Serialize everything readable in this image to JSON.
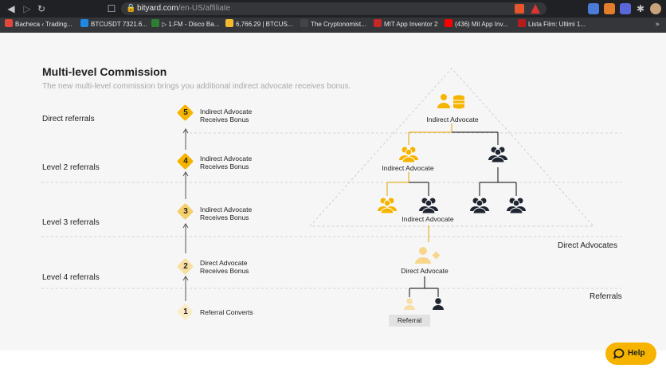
{
  "browser": {
    "url_host": "bityard.com",
    "url_path": "/en-US/affiliate",
    "bookmarks": [
      {
        "label": "Bacheca ‹ Trading...",
        "color": "#e0483e"
      },
      {
        "label": "BTCUSDT 7321.6...",
        "color": "#1e88e5"
      },
      {
        "label": "▷ 1.FM - Disco Ba...",
        "color": "#2e7d32"
      },
      {
        "label": "6,766.29 | BTCUS...",
        "color": "#f3ba2f"
      },
      {
        "label": "The Cryptonomist...",
        "color": "#444444"
      },
      {
        "label": "MIT App Inventor 2",
        "color": "#c62828"
      },
      {
        "label": "(436) Mit App Inv...",
        "color": "#ff0000"
      },
      {
        "label": "Lista Film: Ultimi 1...",
        "color": "#b71c1c"
      }
    ],
    "bookmarks_more": "»"
  },
  "page": {
    "title": "Multi-level Commission",
    "subtitle": "The new multi-level commission brings you additional indirect advocate receives bonus.",
    "levels": {
      "direct": "Direct referrals",
      "level2": "Level 2 referrals",
      "level3": "Level 3 referrals",
      "level4": "Level 4 referrals"
    },
    "steps": [
      {
        "num": "5",
        "line1": "Indirect Advocate",
        "line2": "Receives Bonus",
        "state": "active"
      },
      {
        "num": "4",
        "line1": "Indirect Advocate",
        "line2": "Receives Bonus",
        "state": "active"
      },
      {
        "num": "3",
        "line1": "Indirect Advocate",
        "line2": "Receives Bonus",
        "state": "medium"
      },
      {
        "num": "2",
        "line1": "Direct Advocate",
        "line2": "Receives Bonus",
        "state": "light"
      },
      {
        "num": "1",
        "line1": "Referral Converts",
        "line2": "",
        "state": "lightest"
      }
    ],
    "nodes": {
      "top": "Indirect Advocate",
      "level2": "Indirect Advocate",
      "level3": "Indirect Advocate",
      "direct": "Direct Advocate",
      "referral": "Referral"
    },
    "side_labels": {
      "direct_advocates": "Direct  Advocates",
      "referrals": "Referrals"
    },
    "help": "Help"
  },
  "colors": {
    "accent": "#f6b400",
    "accent_medium": "#f6cf6a",
    "accent_light": "#f8df9f",
    "accent_lightest": "#fbecc6",
    "dark_person": "#1f2530",
    "grid_dash": "#d4d4d4"
  }
}
